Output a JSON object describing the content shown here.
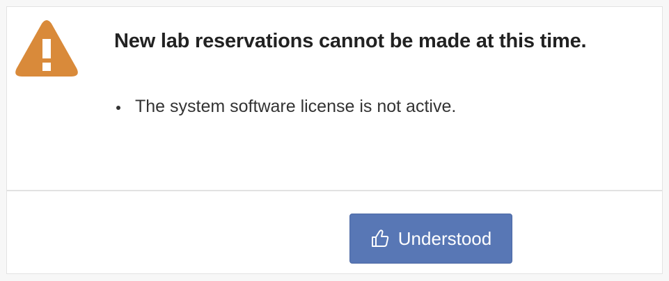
{
  "dialog": {
    "title": "New lab reservations cannot be made at this time.",
    "messages": [
      "The system software license is not active."
    ],
    "icon": "warning-triangle-icon",
    "button": {
      "label": "Understood",
      "icon": "thumbs-up-icon"
    }
  },
  "colors": {
    "warning": "#d98a3a",
    "button": "#5877b5"
  }
}
